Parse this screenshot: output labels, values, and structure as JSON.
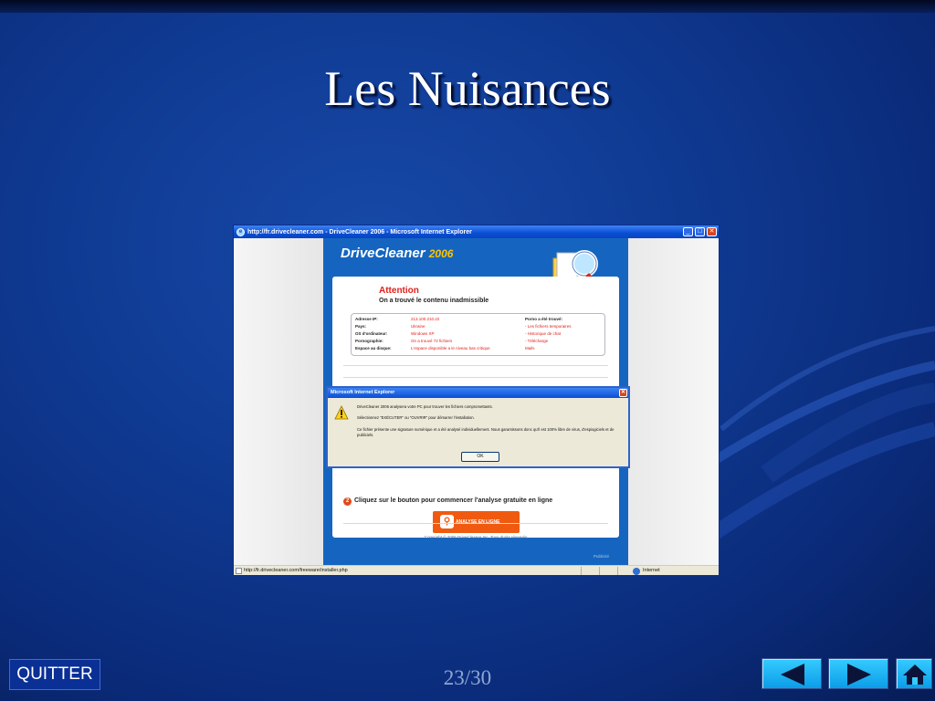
{
  "slide": {
    "title": "Les Nuisances",
    "page_indicator": "23/30"
  },
  "browser": {
    "window_title": "http://fr.drivecleaner.com - DriveCleaner 2006 - Microsoft Internet Explorer",
    "page": {
      "logo_brand": "DriveCleaner",
      "logo_year": "2006",
      "attention_title": "Attention",
      "attention_subtitle": "On a trouvé le contenu inadmissible",
      "info_rows": [
        {
          "label": "Adresse IP:",
          "value": "213.100.210.22"
        },
        {
          "label": "Pays:",
          "value": "Ukraine"
        },
        {
          "label": "OS d'ordinateur:",
          "value": "Windows XP"
        },
        {
          "label": "Pornographie:",
          "value": "On a trouvé 72 fichiers"
        },
        {
          "label": "Espace au disque:",
          "value": "L'espace disponible a le niveau bas critique"
        }
      ],
      "found_title": "Porno a été trouvé:",
      "found_items": [
        "- Les fichiers temporaires",
        "- Historique de chat",
        "- Télécharge",
        "Mails"
      ],
      "step_number": "2",
      "step_text": "Cliquez sur le bouton pour commencer l'analyse gratuite en ligne",
      "scan_button": "ANALYSE EN LIGNE",
      "copyright": "Copyright © 2006 DriveCleaner Inc. Tous droits réservés",
      "publicite": "Publicité"
    },
    "dialog": {
      "title": "Microsoft Internet Explorer",
      "line1": "DriveCleaner 2006 analysera votre PC pour trouver les fichiers compromettants.",
      "line2": "Sélectionnez \"EXÉCUTER\" ou \"OUVRIR\" pour démarrer l'installation.",
      "line3": "Ce fichier présente une signature numérique et a été analysé individuellement. Nous garantissons donc qu'il est 100% libre de virus, d'espiogiciels et de publiciels.",
      "ok_label": "OK"
    },
    "statusbar": {
      "url": "http://fr.drivecleaner.com/freeware/installer.php",
      "zone": "Internet"
    }
  },
  "footer": {
    "quit_label": "QUITTER"
  },
  "icons": {
    "prev": "left-arrow-icon",
    "next": "right-arrow-icon",
    "home": "home-icon"
  },
  "colors": {
    "background": "#0f3a92",
    "nav_button": "#1fb6f5",
    "alert_red": "#e0201a"
  }
}
